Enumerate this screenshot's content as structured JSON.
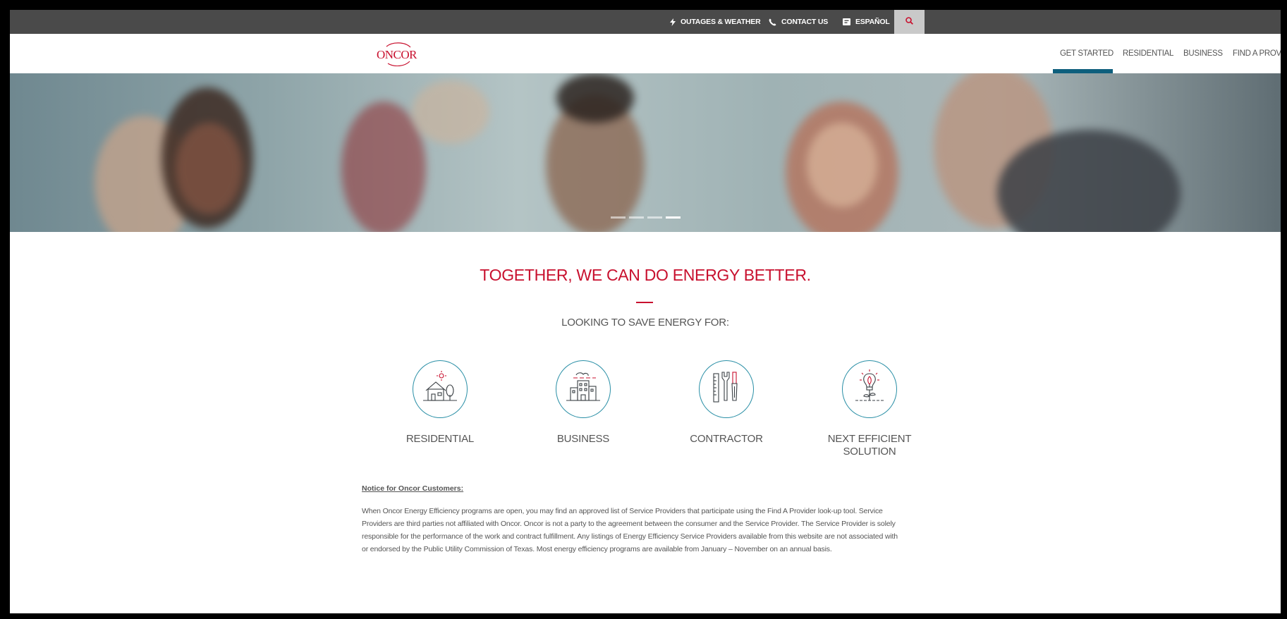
{
  "utility_bar": {
    "outages": "OUTAGES & WEATHER",
    "contact": "CONTACT US",
    "espanol": "ESPAÑOL"
  },
  "header": {
    "logo_text": "ONCOR",
    "nav": [
      "GET STARTED",
      "RESIDENTIAL",
      "BUSINESS",
      "FIND A PROVIDER"
    ],
    "active_nav": "GET STARTED"
  },
  "hero": {
    "slide_count": 4,
    "active_slide": 4
  },
  "main": {
    "headline": "TOGETHER, WE CAN DO ENERGY BETTER.",
    "subhead": "LOOKING TO SAVE ENERGY FOR:",
    "categories": [
      {
        "label": "RESIDENTIAL",
        "icon": "house-icon"
      },
      {
        "label": "BUSINESS",
        "icon": "building-icon"
      },
      {
        "label": "CONTRACTOR",
        "icon": "tools-icon"
      },
      {
        "label": "NEXT EFFICIENT SOLUTION",
        "icon": "lightbulb-icon"
      }
    ],
    "notice_title": "Notice for Oncor Customers:",
    "notice_body": "When Oncor Energy Efficiency programs are open, you may find an approved list of Service Providers that participate using the Find A Provider look-up tool. Service Providers are third parties not affiliated with Oncor. Oncor is not a party to the agreement between the consumer and the Service Provider. The Service Provider is solely responsible for the performance of the work and contract fulfillment. Any listings of Energy Efficiency Service Providers available from this website are not associated with or endorsed by the Public Utility Commission of Texas. Most energy efficiency programs are available from January – November on an annual basis."
  },
  "colors": {
    "brand_red": "#c8102e",
    "accent_teal": "#2a8fa6",
    "utility_bar": "#4a4a4a",
    "active_nav_bar": "#0e5f7d"
  }
}
